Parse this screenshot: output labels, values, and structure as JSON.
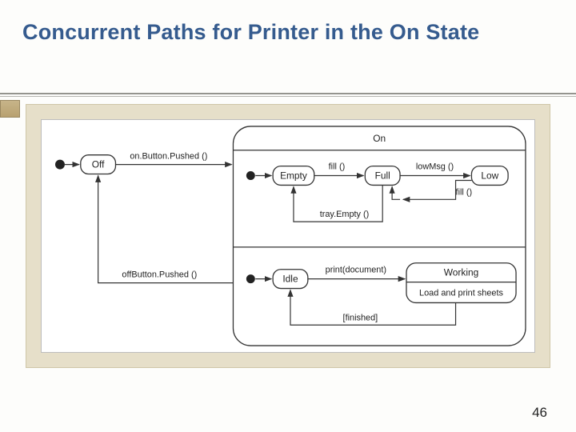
{
  "title": "Concurrent Paths for Printer in the On State",
  "page": "46",
  "diagram": {
    "compositeLabel": "On",
    "states": {
      "off": "Off",
      "empty": "Empty",
      "full": "Full",
      "low": "Low",
      "idle": "Idle",
      "working": "Working",
      "workingDo": "Load and print sheets"
    },
    "transitions": {
      "onButton": "on.Button.Pushed ()",
      "offButton": "offButton.Pushed ()",
      "fill1": "fill ()",
      "lowMsg": "lowMsg ()",
      "fill2": "fill ()",
      "trayEmpty": "tray.Empty ()",
      "print": "print(document)",
      "finished": "[finished]"
    }
  }
}
